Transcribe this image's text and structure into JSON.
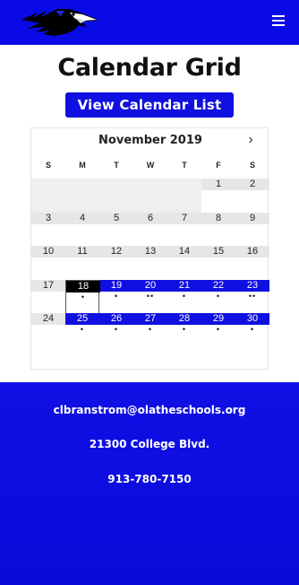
{
  "header": {
    "logo_icon": "raven-head-logo",
    "menu_icon": "hamburger-menu-icon"
  },
  "page": {
    "title": "Calendar Grid",
    "view_list_label": "View Calendar List"
  },
  "calendar": {
    "month_label": "November 2019",
    "next_icon": "›",
    "weekdays": [
      "S",
      "M",
      "T",
      "W",
      "T",
      "F",
      "S"
    ],
    "weeks": [
      [
        {
          "day": "",
          "dots": ""
        },
        {
          "day": "",
          "dots": ""
        },
        {
          "day": "",
          "dots": ""
        },
        {
          "day": "",
          "dots": ""
        },
        {
          "day": "",
          "dots": ""
        },
        {
          "day": "1",
          "dots": ""
        },
        {
          "day": "2",
          "dots": ""
        }
      ],
      [
        {
          "day": "3",
          "dots": ""
        },
        {
          "day": "4",
          "dots": ""
        },
        {
          "day": "5",
          "dots": ""
        },
        {
          "day": "6",
          "dots": ""
        },
        {
          "day": "7",
          "dots": ""
        },
        {
          "day": "8",
          "dots": ""
        },
        {
          "day": "9",
          "dots": ""
        }
      ],
      [
        {
          "day": "10",
          "dots": ""
        },
        {
          "day": "11",
          "dots": ""
        },
        {
          "day": "12",
          "dots": ""
        },
        {
          "day": "13",
          "dots": ""
        },
        {
          "day": "14",
          "dots": ""
        },
        {
          "day": "15",
          "dots": ""
        },
        {
          "day": "16",
          "dots": ""
        }
      ],
      [
        {
          "day": "17",
          "dots": ""
        },
        {
          "day": "18",
          "dots": "•"
        },
        {
          "day": "19",
          "dots": "•"
        },
        {
          "day": "20",
          "dots": "••"
        },
        {
          "day": "21",
          "dots": "•"
        },
        {
          "day": "22",
          "dots": "•"
        },
        {
          "day": "23",
          "dots": "••"
        }
      ],
      [
        {
          "day": "24",
          "dots": ""
        },
        {
          "day": "25",
          "dots": "•"
        },
        {
          "day": "26",
          "dots": "•"
        },
        {
          "day": "27",
          "dots": "•"
        },
        {
          "day": "28",
          "dots": "•"
        },
        {
          "day": "29",
          "dots": "•"
        },
        {
          "day": "30",
          "dots": "•"
        }
      ]
    ],
    "today": "18",
    "colors": {
      "event_band": "#1010e0",
      "plain_band": "#e6e6e6",
      "today": "#000000"
    }
  },
  "footer": {
    "email": "clbranstrom@olatheschools.org",
    "address": "21300 College Blvd.",
    "phone": "913-780-7150"
  },
  "colors": {
    "brand_blue": "#0a0ae6",
    "button_blue": "#1010e0"
  }
}
